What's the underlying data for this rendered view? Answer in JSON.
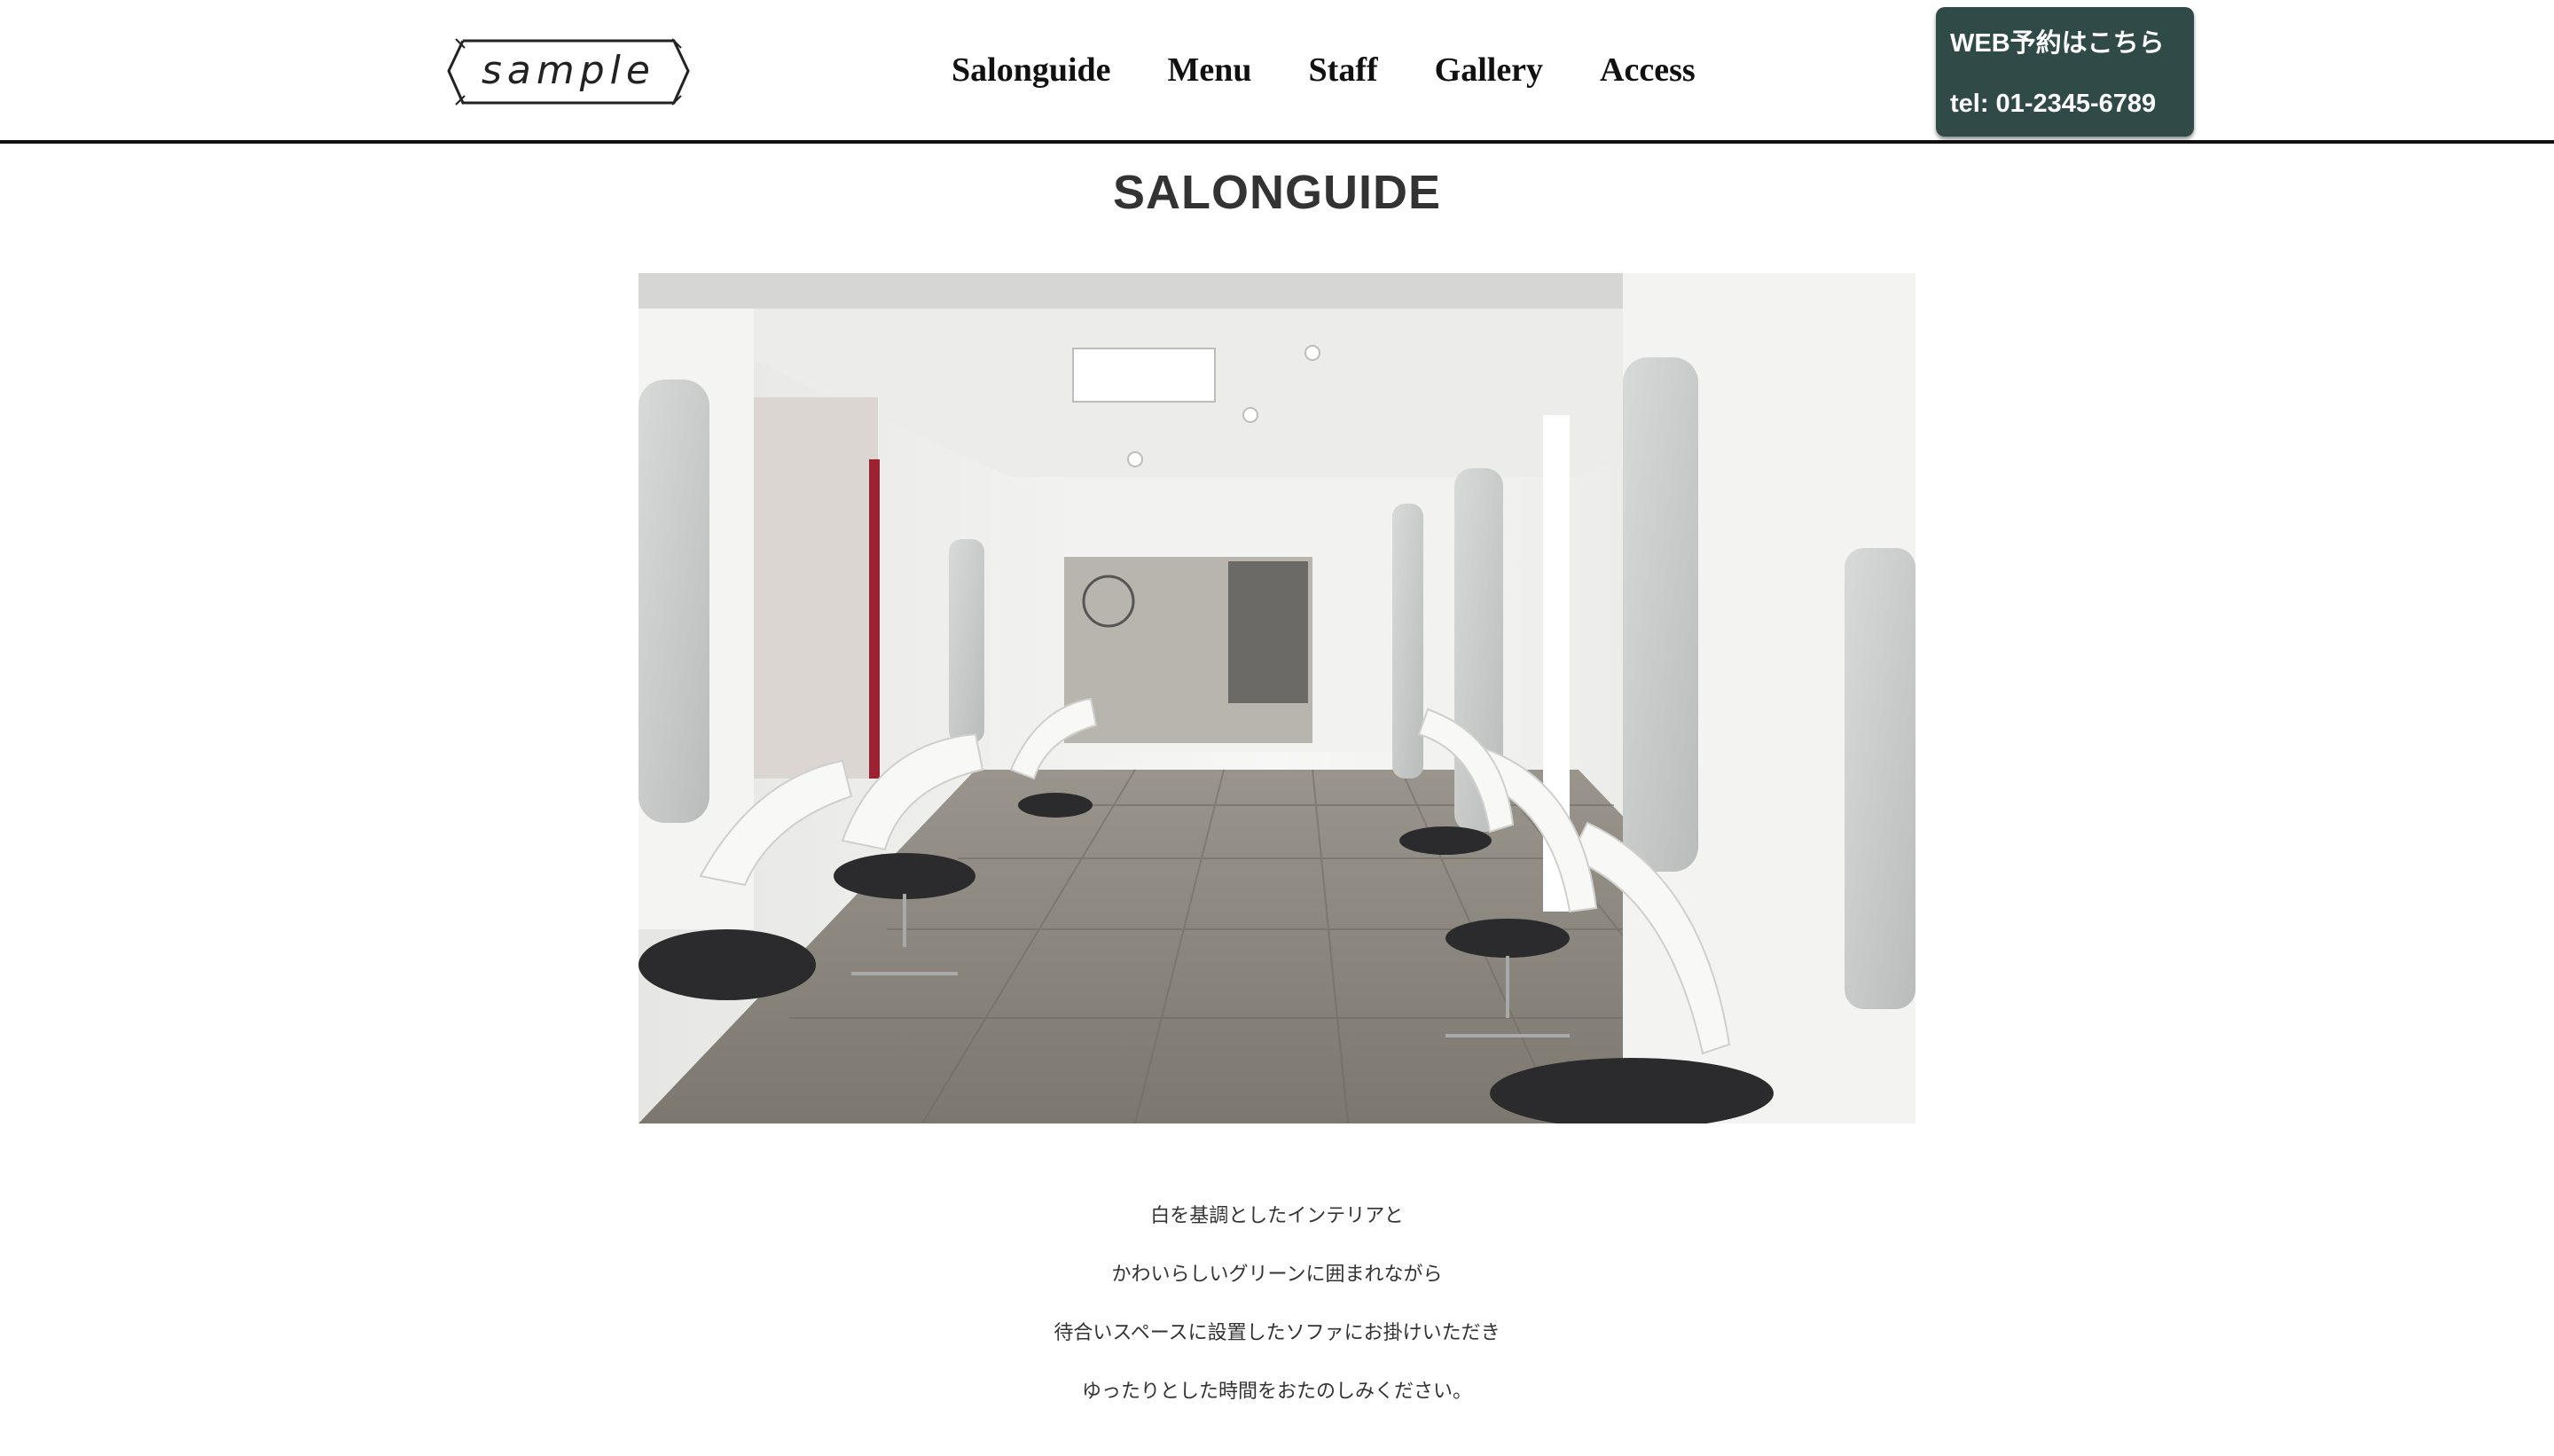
{
  "header": {
    "logo_text": "sample",
    "nav": [
      "Salonguide",
      "Menu",
      "Staff",
      "Gallery",
      "Access"
    ],
    "cta": {
      "reserve_label": "WEB予約はこちら",
      "tel_label": "tel: 01-2345-6789",
      "background": "#2f4a47"
    }
  },
  "main": {
    "title": "SALONGUIDE",
    "description": [
      "白を基調としたインテリアと",
      "かわいらしいグリーンに囲まれながら",
      "待合いスペースに設置したソファにお掛けいただき",
      "ゆったりとした時間をおたのしみください。"
    ]
  }
}
